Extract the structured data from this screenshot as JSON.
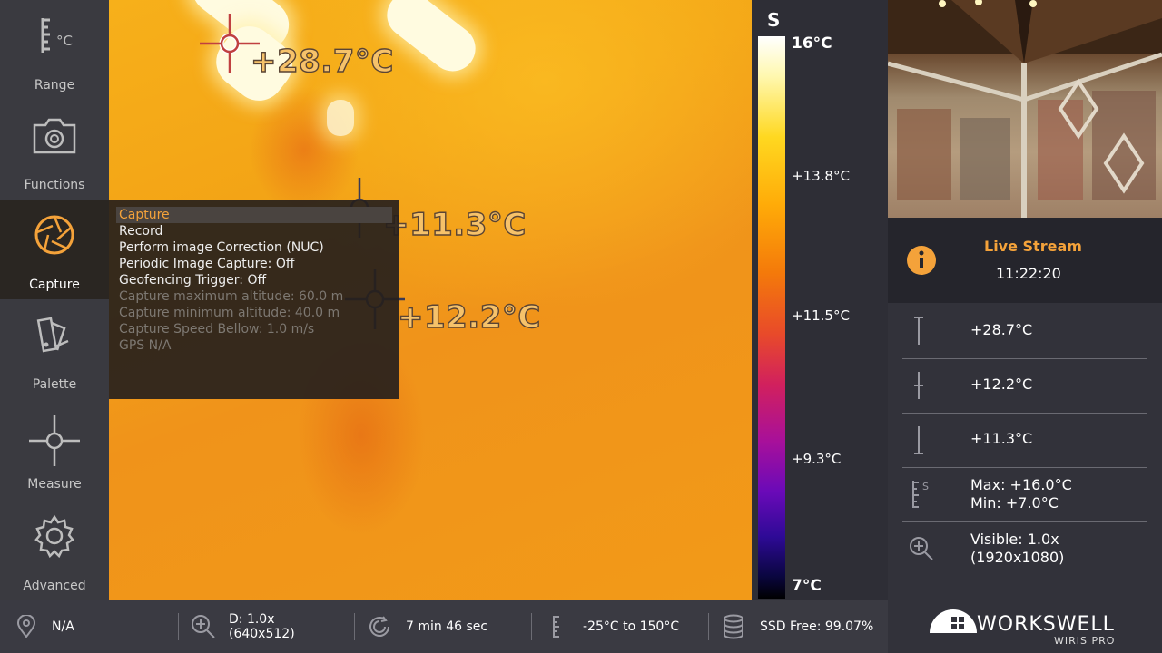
{
  "sidebar": {
    "items": [
      {
        "label": "Range",
        "icon": "range-scale-icon"
      },
      {
        "label": "Functions",
        "icon": "camera-icon"
      },
      {
        "label": "Capture",
        "icon": "aperture-icon"
      },
      {
        "label": "Palette",
        "icon": "palette-swatch-icon"
      },
      {
        "label": "Measure",
        "icon": "crosshair-icon"
      },
      {
        "label": "Advanced",
        "icon": "gear-icon"
      }
    ],
    "range_unit": "°C"
  },
  "thermal": {
    "spots": [
      {
        "label": "+28.7°C",
        "kind": "max"
      },
      {
        "label": "+11.3°C",
        "kind": "min"
      },
      {
        "label": "+12.2°C",
        "kind": "center"
      }
    ]
  },
  "capture_menu": {
    "items": [
      {
        "label": "Capture",
        "state": "selected"
      },
      {
        "label": "Record",
        "state": "enabled"
      },
      {
        "label": "Perform image Correction (NUC)",
        "state": "enabled"
      },
      {
        "label": "Periodic Image Capture: Off",
        "state": "enabled"
      },
      {
        "label": "Geofencing Trigger: Off",
        "state": "enabled"
      },
      {
        "label": "Capture maximum altitude: 60.0 m",
        "state": "disabled"
      },
      {
        "label": "Capture minimum altitude: 40.0 m",
        "state": "disabled"
      },
      {
        "label": "Capture Speed Bellow: 1.0 m/s",
        "state": "disabled"
      },
      {
        "label": "GPS N/A",
        "state": "disabled"
      }
    ]
  },
  "palette": {
    "mode": "S",
    "max": "16°C",
    "min": "7°C",
    "ticks": [
      "+13.8°C",
      "+11.5°C",
      "+9.3°C"
    ]
  },
  "right_panel": {
    "live_title": "Live Stream",
    "live_time": "11:22:20",
    "max_temp": "+28.7°C",
    "center_temp": "+12.2°C",
    "min_temp": "+11.3°C",
    "range_max": "Max: +16.0°C",
    "range_min": "Min: +7.0°C",
    "visible_zoom": "Visible: 1.0x",
    "visible_res": "(1920x1080)"
  },
  "bottom": {
    "gps": "N/A",
    "zoom": "D: 1.0x",
    "zoom_res": "(640x512)",
    "timer": "7 min 46 sec",
    "range": "-25°C to 150°C",
    "storage": "SSD Free: 99.07%"
  },
  "logo": {
    "brand": "WORKSWELL",
    "product": "WIRIS PRO"
  },
  "colors": {
    "accent": "#f4a23a",
    "sidebar_bg": "#3a3a40",
    "panel_bg": "#32323a"
  }
}
